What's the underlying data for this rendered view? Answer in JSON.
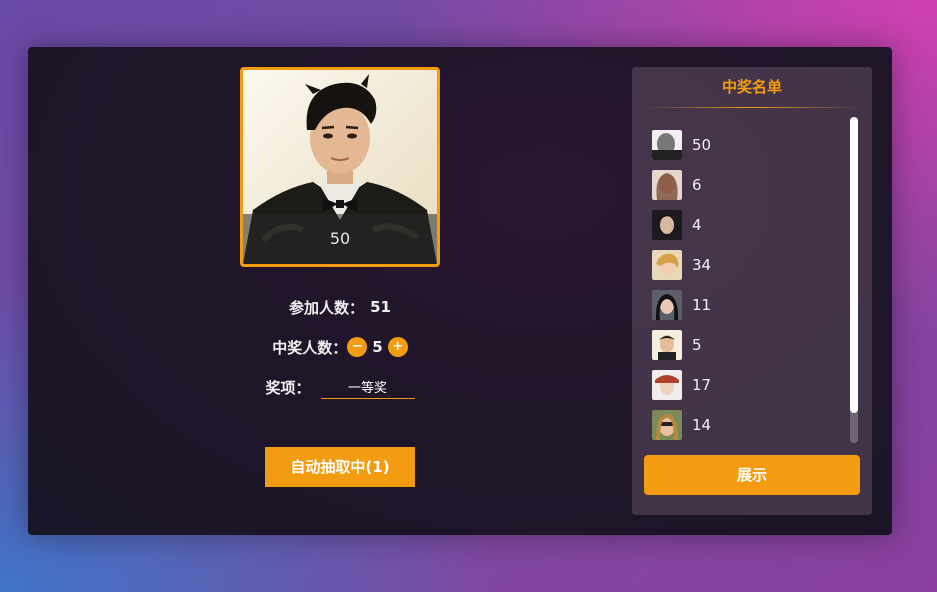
{
  "draw": {
    "current_number": "50",
    "participants_label": "参加人数：",
    "participants_value": "51",
    "winners_label": "中奖人数：",
    "winners_count": "5",
    "decrement_symbol": "−",
    "increment_symbol": "+",
    "prize_label": "奖项：",
    "prize_value": "一等奖",
    "auto_button_label": "自动抽取中(1)"
  },
  "winner_list": {
    "title": "中奖名单",
    "items": [
      {
        "name": "50",
        "avatar_color": "#c9c9c9"
      },
      {
        "name": "6",
        "avatar_color": "#8a5a48"
      },
      {
        "name": "4",
        "avatar_color": "#2c2a30"
      },
      {
        "name": "34",
        "avatar_color": "#d7b07a"
      },
      {
        "name": "11",
        "avatar_color": "#3a3a4a"
      },
      {
        "name": "5",
        "avatar_color": "#efe4cc"
      },
      {
        "name": "17",
        "avatar_color": "#e8ddd6"
      },
      {
        "name": "14",
        "avatar_color": "#7a6a4a"
      }
    ],
    "show_button_label": "展示"
  },
  "colors": {
    "accent": "#f39c12",
    "panel_bg": "#1f1529"
  },
  "icons": [
    "decrement-icon",
    "increment-icon"
  ]
}
